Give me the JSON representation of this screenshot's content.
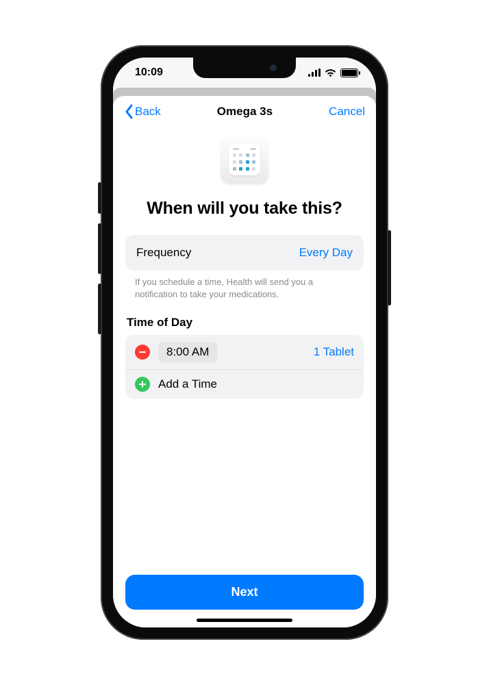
{
  "status": {
    "time": "10:09"
  },
  "nav": {
    "back": "Back",
    "title": "Omega 3s",
    "cancel": "Cancel"
  },
  "page": {
    "headline": "When will you take this?",
    "frequency": {
      "label": "Frequency",
      "value": "Every Day"
    },
    "caption": "If you schedule a time, Health will send you a notification to take your medications.",
    "tod_title": "Time of Day",
    "times": [
      {
        "time": "8:00 AM",
        "dose": "1 Tablet"
      }
    ],
    "add_time": "Add a Time",
    "next": "Next"
  }
}
